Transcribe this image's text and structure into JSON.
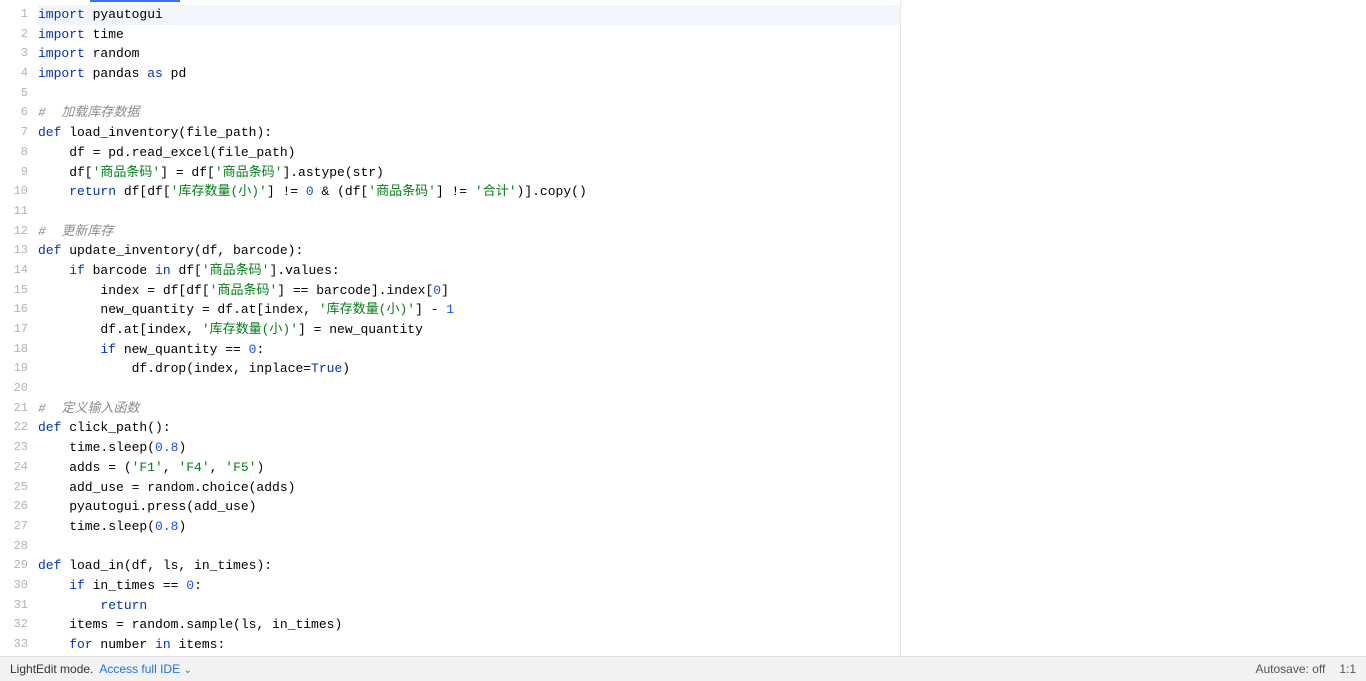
{
  "file_language": "python",
  "code_lines": [
    {
      "n": 1,
      "tokens": [
        [
          "kw",
          "import"
        ],
        [
          "p",
          " pyautogui"
        ]
      ]
    },
    {
      "n": 2,
      "tokens": [
        [
          "kw",
          "import"
        ],
        [
          "p",
          " time"
        ]
      ]
    },
    {
      "n": 3,
      "tokens": [
        [
          "kw",
          "import"
        ],
        [
          "p",
          " random"
        ]
      ]
    },
    {
      "n": 4,
      "tokens": [
        [
          "kw",
          "import"
        ],
        [
          "p",
          " pandas "
        ],
        [
          "kw",
          "as"
        ],
        [
          "p",
          " pd"
        ]
      ]
    },
    {
      "n": 5,
      "tokens": []
    },
    {
      "n": 6,
      "tokens": [
        [
          "com",
          "#  加载库存数据"
        ]
      ]
    },
    {
      "n": 7,
      "tokens": [
        [
          "kw",
          "def"
        ],
        [
          "p",
          " load_inventory(file_path):"
        ]
      ]
    },
    {
      "n": 8,
      "tokens": [
        [
          "p",
          "    df = pd.read_excel(file_path)"
        ]
      ]
    },
    {
      "n": 9,
      "tokens": [
        [
          "p",
          "    df["
        ],
        [
          "str",
          "'商品条码'"
        ],
        [
          "p",
          "] = df["
        ],
        [
          "str",
          "'商品条码'"
        ],
        [
          "p",
          "].astype(str)"
        ]
      ]
    },
    {
      "n": 10,
      "tokens": [
        [
          "p",
          "    "
        ],
        [
          "kw",
          "return"
        ],
        [
          "p",
          " df[df["
        ],
        [
          "str",
          "'库存数量(小)'"
        ],
        [
          "p",
          "] != "
        ],
        [
          "num",
          "0"
        ],
        [
          "p",
          " & (df["
        ],
        [
          "str",
          "'商品条码'"
        ],
        [
          "p",
          "] != "
        ],
        [
          "str",
          "'合计'"
        ],
        [
          "p",
          ")].copy()"
        ]
      ]
    },
    {
      "n": 11,
      "tokens": []
    },
    {
      "n": 12,
      "tokens": [
        [
          "com",
          "#  更新库存"
        ]
      ]
    },
    {
      "n": 13,
      "tokens": [
        [
          "kw",
          "def"
        ],
        [
          "p",
          " update_inventory(df, barcode):"
        ]
      ]
    },
    {
      "n": 14,
      "tokens": [
        [
          "p",
          "    "
        ],
        [
          "kw",
          "if"
        ],
        [
          "p",
          " barcode "
        ],
        [
          "kw",
          "in"
        ],
        [
          "p",
          " df["
        ],
        [
          "str",
          "'商品条码'"
        ],
        [
          "p",
          "].values:"
        ]
      ]
    },
    {
      "n": 15,
      "tokens": [
        [
          "p",
          "        index = df[df["
        ],
        [
          "str",
          "'商品条码'"
        ],
        [
          "p",
          "] == barcode].index["
        ],
        [
          "num",
          "0"
        ],
        [
          "p",
          "]"
        ]
      ]
    },
    {
      "n": 16,
      "tokens": [
        [
          "p",
          "        new_quantity = df.at[index, "
        ],
        [
          "str",
          "'库存数量(小)'"
        ],
        [
          "p",
          "] - "
        ],
        [
          "num",
          "1"
        ]
      ]
    },
    {
      "n": 17,
      "tokens": [
        [
          "p",
          "        df.at[index, "
        ],
        [
          "str",
          "'库存数量(小)'"
        ],
        [
          "p",
          "] = new_quantity"
        ]
      ]
    },
    {
      "n": 18,
      "tokens": [
        [
          "p",
          "        "
        ],
        [
          "kw",
          "if"
        ],
        [
          "p",
          " new_quantity == "
        ],
        [
          "num",
          "0"
        ],
        [
          "p",
          ":"
        ]
      ]
    },
    {
      "n": 19,
      "tokens": [
        [
          "p",
          "            df.drop(index, inplace="
        ],
        [
          "kw",
          "True"
        ],
        [
          "p",
          ")"
        ]
      ]
    },
    {
      "n": 20,
      "tokens": []
    },
    {
      "n": 21,
      "tokens": [
        [
          "com",
          "#  定义输入函数"
        ]
      ]
    },
    {
      "n": 22,
      "tokens": [
        [
          "kw",
          "def"
        ],
        [
          "p",
          " click_path():"
        ]
      ]
    },
    {
      "n": 23,
      "tokens": [
        [
          "p",
          "    time.sleep("
        ],
        [
          "num",
          "0.8"
        ],
        [
          "p",
          ")"
        ]
      ]
    },
    {
      "n": 24,
      "tokens": [
        [
          "p",
          "    adds = ("
        ],
        [
          "str",
          "'F1'"
        ],
        [
          "p",
          ", "
        ],
        [
          "str",
          "'F4'"
        ],
        [
          "p",
          ", "
        ],
        [
          "str",
          "'F5'"
        ],
        [
          "p",
          ")"
        ]
      ]
    },
    {
      "n": 25,
      "tokens": [
        [
          "p",
          "    add_use = random.choice(adds)"
        ]
      ]
    },
    {
      "n": 26,
      "tokens": [
        [
          "p",
          "    pyautogui.press(add_use)"
        ]
      ]
    },
    {
      "n": 27,
      "tokens": [
        [
          "p",
          "    time.sleep("
        ],
        [
          "num",
          "0.8"
        ],
        [
          "p",
          ")"
        ]
      ]
    },
    {
      "n": 28,
      "tokens": []
    },
    {
      "n": 29,
      "tokens": [
        [
          "kw",
          "def"
        ],
        [
          "p",
          " load_in(df, ls, in_times):"
        ]
      ]
    },
    {
      "n": 30,
      "tokens": [
        [
          "p",
          "    "
        ],
        [
          "kw",
          "if"
        ],
        [
          "p",
          " in_times == "
        ],
        [
          "num",
          "0"
        ],
        [
          "p",
          ":"
        ]
      ]
    },
    {
      "n": 31,
      "tokens": [
        [
          "p",
          "        "
        ],
        [
          "kw",
          "return"
        ]
      ]
    },
    {
      "n": 32,
      "tokens": [
        [
          "p",
          "    items = random.sample(ls, in_times)"
        ]
      ]
    },
    {
      "n": 33,
      "tokens": [
        [
          "p",
          "    "
        ],
        [
          "kw",
          "for"
        ],
        [
          "p",
          " number "
        ],
        [
          "kw",
          "in"
        ],
        [
          "p",
          " items:"
        ]
      ]
    }
  ],
  "status": {
    "mode_label": "LightEdit mode.",
    "ide_link": "Access full IDE",
    "autosave_label": "Autosave: off",
    "cursor_pos": "1:1"
  }
}
